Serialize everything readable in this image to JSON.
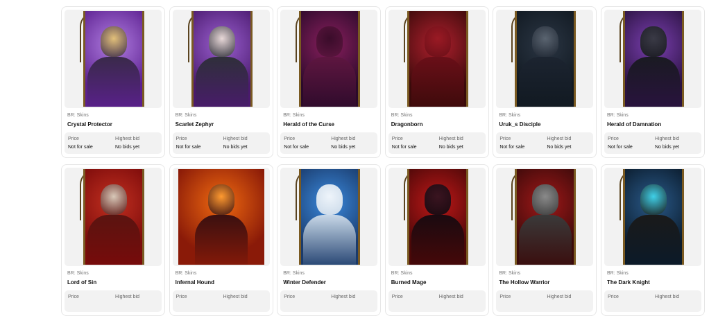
{
  "labels": {
    "price": "Price",
    "highest_bid": "Highest bid"
  },
  "items": [
    {
      "category": "BR: Skins",
      "name": "Crystal Protector",
      "price": "Not for sale",
      "bid": "No bids yet",
      "palette": [
        "#5b1f8f",
        "#b07de0",
        "#3a2a4a",
        "#e2c07a"
      ]
    },
    {
      "category": "BR: Skins",
      "name": "Scarlet Zephyr",
      "price": "Not for sale",
      "bid": "No bids yet",
      "palette": [
        "#4a1a6e",
        "#9a5fcf",
        "#2f2f3a",
        "#e8d8d8"
      ]
    },
    {
      "category": "BR: Skins",
      "name": "Herald of the Curse",
      "price": "Not for sale",
      "bid": "No bids yet",
      "palette": [
        "#2b0a2a",
        "#8a1f5e",
        "#5e1640",
        "#3a0c2a"
      ]
    },
    {
      "category": "BR: Skins",
      "name": "Dragonborn",
      "price": "Not for sale",
      "bid": "No bids yet",
      "palette": [
        "#3a0a0a",
        "#b0202e",
        "#6a0f18",
        "#9a1a24"
      ]
    },
    {
      "category": "BR: Skins",
      "name": "Uruk_s Disciple",
      "price": "Not for sale",
      "bid": "No bids yet",
      "palette": [
        "#101820",
        "#2b3644",
        "#1c2430",
        "#5a6470"
      ]
    },
    {
      "category": "BR: Skins",
      "name": "Herald of Damnation",
      "price": "Not for sale",
      "bid": "No bids yet",
      "palette": [
        "#2a1240",
        "#7a3fb0",
        "#1a1a22",
        "#3a3a46"
      ]
    },
    {
      "category": "BR: Skins",
      "name": "Lord of Sin",
      "price": "",
      "bid": "",
      "palette": [
        "#7a0a0a",
        "#c23020",
        "#5a1410",
        "#d8c8b8"
      ]
    },
    {
      "category": "BR: Skins",
      "name": "Infernal Hound",
      "price": "",
      "bid": "",
      "palette": [
        "#8a1a08",
        "#f06a10",
        "#3a1010",
        "#ff9a30"
      ]
    },
    {
      "category": "BR: Skins",
      "name": "Winter Defender",
      "price": "",
      "bid": "",
      "palette": [
        "#1a3a6a",
        "#3a8adf",
        "#c8d8e8",
        "#eef4fa"
      ]
    },
    {
      "category": "BR: Skins",
      "name": "Burned Mage",
      "price": "",
      "bid": "",
      "palette": [
        "#4a0808",
        "#c01818",
        "#1a0a10",
        "#3a1420"
      ]
    },
    {
      "category": "BR: Skins",
      "name": "The Hollow Warrior",
      "price": "",
      "bid": "",
      "palette": [
        "#3a0a0a",
        "#a01818",
        "#3a3a3a",
        "#8a8a8a"
      ]
    },
    {
      "category": "BR: Skins",
      "name": "The Dark Knight",
      "price": "",
      "bid": "",
      "palette": [
        "#0a1a2a",
        "#2a5a8a",
        "#1a1a1a",
        "#3fd0e8"
      ]
    }
  ]
}
